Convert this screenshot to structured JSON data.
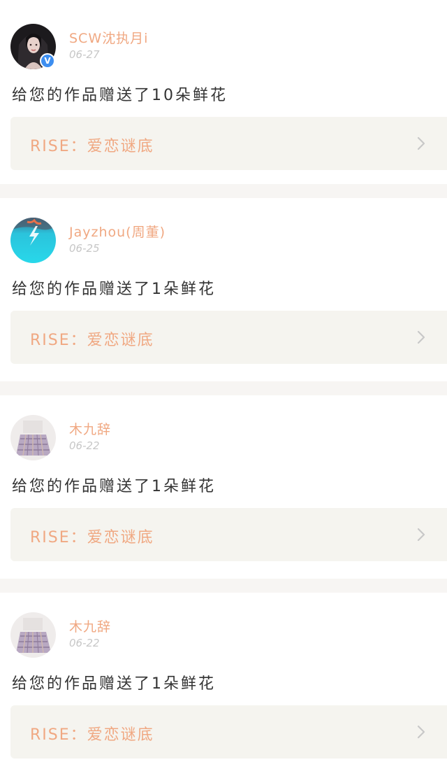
{
  "colors": {
    "accent": "#f0a882",
    "page_background": "#f7f5f3",
    "link_card_background": "#f5f4ef",
    "verified_badge": "#3d8ef0"
  },
  "notifications": [
    {
      "username": "SCW沈执月i",
      "date": "06-27",
      "message": "给您的作品赠送了10朵鲜花",
      "work_title": "RISE：爱恋谜底",
      "verified": true,
      "verified_badge": "V",
      "avatar_icon": "avatar-dark-hair-portrait"
    },
    {
      "username": "Jayzhou(周董)",
      "date": "06-25",
      "message": "给您的作品赠送了1朵鲜花",
      "work_title": "RISE：爱恋谜底",
      "verified": false,
      "avatar_icon": "avatar-cyan-lightning"
    },
    {
      "username": "木九辞",
      "date": "06-22",
      "message": "给您的作品赠送了1朵鲜花",
      "work_title": "RISE：爱恋谜底",
      "verified": false,
      "avatar_icon": "avatar-plaid-skirt"
    },
    {
      "username": "木九辞",
      "date": "06-22",
      "message": "给您的作品赠送了1朵鲜花",
      "work_title": "RISE：爱恋谜底",
      "verified": false,
      "avatar_icon": "avatar-plaid-skirt"
    }
  ]
}
